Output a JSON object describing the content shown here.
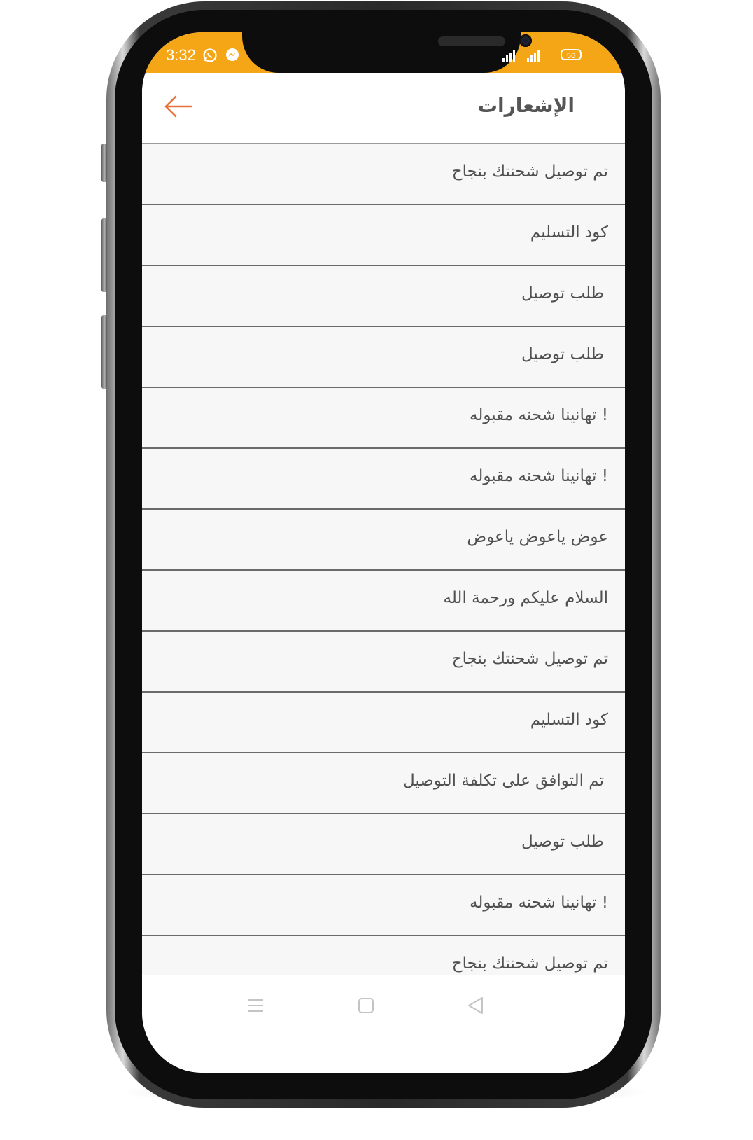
{
  "status_bar": {
    "time": "3:32",
    "icons": [
      "whatsapp-icon",
      "messenger-icon"
    ],
    "battery": "56",
    "color": "#f5a617"
  },
  "header": {
    "title": "الإشعارات",
    "back_icon": "arrow-left-icon",
    "back_color": "#e8733a"
  },
  "notifications": [
    {
      "text": "تم توصيل شحنتك بنجاح"
    },
    {
      "text": "كود التسليم"
    },
    {
      "text": "طلب توصيل"
    },
    {
      "text": "طلب توصيل"
    },
    {
      "text": "! تهانينا شحنه مقبوله"
    },
    {
      "text": "! تهانينا شحنه مقبوله"
    },
    {
      "text": "عوض ياعوض ياعوض"
    },
    {
      "text": "السلام عليكم ورحمة الله"
    },
    {
      "text": "تم توصيل شحنتك بنجاح"
    },
    {
      "text": "كود التسليم"
    },
    {
      "text": "تم التوافق على تكلفة التوصيل"
    },
    {
      "text": "طلب توصيل"
    },
    {
      "text": "! تهانينا شحنه مقبوله"
    },
    {
      "text": "تم توصيل شحنتك بنجاح"
    }
  ],
  "nav_bar": {
    "icons": [
      "menu-icon",
      "home-square-icon",
      "back-triangle-icon"
    ]
  }
}
